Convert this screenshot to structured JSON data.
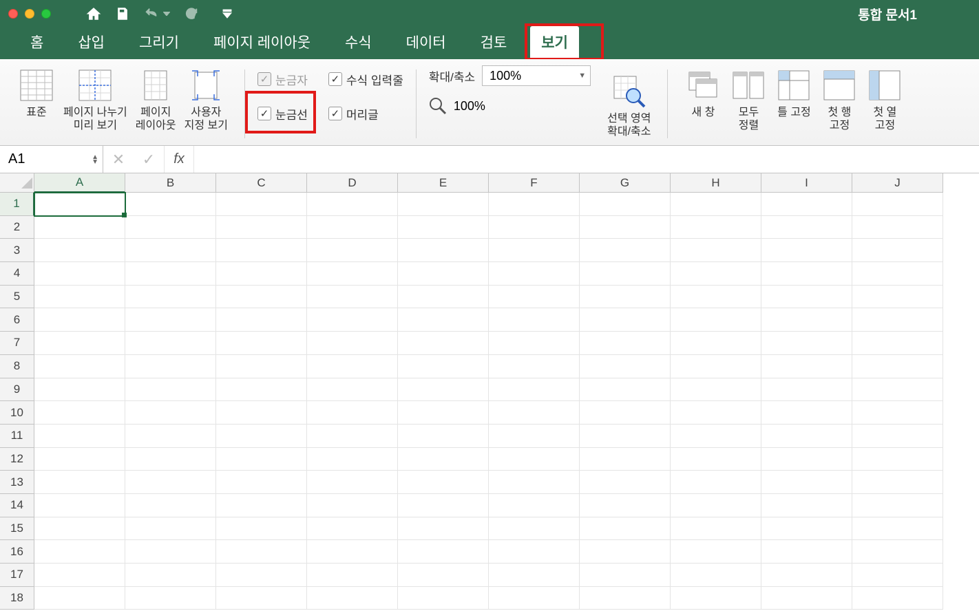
{
  "window": {
    "title": "통합 문서1"
  },
  "qat": {
    "home_tip": "home",
    "save_tip": "save",
    "undo_tip": "undo",
    "redo_tip": "redo",
    "customize_tip": "customize"
  },
  "tabs": {
    "items": [
      "홈",
      "삽입",
      "그리기",
      "페이지 레이아웃",
      "수식",
      "데이터",
      "검토",
      "보기"
    ],
    "active_index": 7
  },
  "ribbon": {
    "views": {
      "normal": "표준",
      "page_break": "페이지 나누기\n미리 보기",
      "page_layout": "페이지\n레이아웃",
      "custom": "사용자\n지정 보기"
    },
    "show": {
      "ruler": "눈금자",
      "gridlines": "눈금선",
      "formula_bar": "수식 입력줄",
      "headings": "머리글",
      "ruler_checked": true,
      "gridlines_checked": true,
      "formula_bar_checked": true,
      "headings_checked": true
    },
    "zoom": {
      "label": "확대/축소",
      "value": "100%",
      "hundred": "100%",
      "to_selection": "선택 영역\n확대/축소"
    },
    "window": {
      "new_window": "새 창",
      "arrange_all": "모두\n정렬",
      "freeze_panes": "틀 고정",
      "freeze_top_row": "첫 행\n고정",
      "freeze_first_col": "첫 열\n고정"
    }
  },
  "formula_bar": {
    "namebox": "A1",
    "fx": "fx",
    "formula": ""
  },
  "grid": {
    "columns": [
      "A",
      "B",
      "C",
      "D",
      "E",
      "F",
      "G",
      "H",
      "I",
      "J"
    ],
    "rows": [
      1,
      2,
      3,
      4,
      5,
      6,
      7,
      8,
      9,
      10,
      11,
      12,
      13,
      14,
      15,
      16,
      17,
      18
    ],
    "selected": {
      "col": "A",
      "row": 1
    }
  }
}
